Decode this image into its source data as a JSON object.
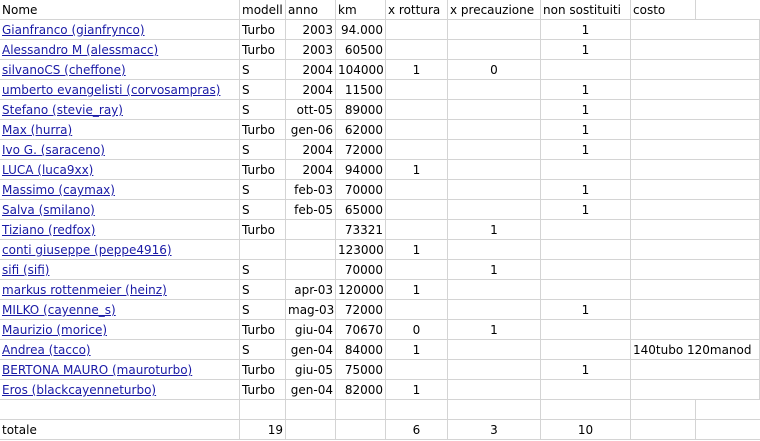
{
  "headers": [
    "Nome",
    "modell",
    "anno",
    "km",
    "x rottura",
    "x precauzione",
    "non sostituiti",
    "costo",
    ""
  ],
  "rows": [
    {
      "name": "Gianfranco (gianfrynco)",
      "modell": "Turbo",
      "anno": "2003",
      "km": "94.000",
      "rottura": "",
      "precauzione": "",
      "non_sostituiti": "1",
      "costo": ""
    },
    {
      "name": "Alessandro M (alessmacc)",
      "modell": "Turbo",
      "anno": "2003",
      "km": "60500",
      "rottura": "",
      "precauzione": "",
      "non_sostituiti": "1",
      "costo": ""
    },
    {
      "name": "silvanoCS (cheffone)",
      "modell": "S",
      "anno": "2004",
      "km": "104000",
      "rottura": "1",
      "precauzione": "0",
      "non_sostituiti": "",
      "costo": ""
    },
    {
      "name": "umberto evangelisti (corvosampras)",
      "modell": "S",
      "anno": "2004",
      "km": "11500",
      "rottura": "",
      "precauzione": "",
      "non_sostituiti": "1",
      "costo": ""
    },
    {
      "name": "Stefano (stevie_ray)",
      "modell": "S",
      "anno": "ott-05",
      "km": "89000",
      "rottura": "",
      "precauzione": "",
      "non_sostituiti": "1",
      "costo": ""
    },
    {
      "name": "Max (hurra)",
      "modell": "Turbo",
      "anno": "gen-06",
      "km": "62000",
      "rottura": "",
      "precauzione": "",
      "non_sostituiti": "1",
      "costo": ""
    },
    {
      "name": "Ivo G. (saraceno)",
      "modell": "S",
      "anno": "2004",
      "km": "72000",
      "rottura": "",
      "precauzione": "",
      "non_sostituiti": "1",
      "costo": ""
    },
    {
      "name": "LUCA (luca9xx)",
      "modell": "Turbo",
      "anno": "2004",
      "km": "94000",
      "rottura": "1",
      "precauzione": "",
      "non_sostituiti": "",
      "costo": ""
    },
    {
      "name": "Massimo (caymax)",
      "modell": "S",
      "anno": "feb-03",
      "km": "70000",
      "rottura": "",
      "precauzione": "",
      "non_sostituiti": "1",
      "costo": ""
    },
    {
      "name": "Salva (smilano)",
      "modell": "S",
      "anno": "feb-05",
      "km": "65000",
      "rottura": "",
      "precauzione": "",
      "non_sostituiti": "1",
      "costo": ""
    },
    {
      "name": "Tiziano (redfox)",
      "modell": "Turbo",
      "anno": "",
      "km": "73321",
      "rottura": "",
      "precauzione": "1",
      "non_sostituiti": "",
      "costo": ""
    },
    {
      "name": "conti giuseppe (peppe4916)",
      "modell": "",
      "anno": "",
      "km": "123000",
      "rottura": "1",
      "precauzione": "",
      "non_sostituiti": "",
      "costo": ""
    },
    {
      "name": "sifi (sifi)",
      "modell": "S",
      "anno": "",
      "km": "70000",
      "rottura": "",
      "precauzione": "1",
      "non_sostituiti": "",
      "costo": ""
    },
    {
      "name": "markus rottenmeier (heinz)",
      "modell": "S",
      "anno": "apr-03",
      "km": "120000",
      "rottura": "1",
      "precauzione": "",
      "non_sostituiti": "",
      "costo": ""
    },
    {
      "name": "MILKO (cayenne_s)",
      "modell": "S",
      "anno": "mag-03",
      "km": "72000",
      "rottura": "",
      "precauzione": "",
      "non_sostituiti": "1",
      "costo": ""
    },
    {
      "name": "Maurizio (morice)",
      "modell": "Turbo",
      "anno": "giu-04",
      "km": "70670",
      "rottura": "0",
      "precauzione": "1",
      "non_sostituiti": "",
      "costo": ""
    },
    {
      "name": "Andrea (tacco)",
      "modell": "S",
      "anno": "gen-04",
      "km": "84000",
      "rottura": "1",
      "precauzione": "",
      "non_sostituiti": "",
      "costo": "140tubo 120manod"
    },
    {
      "name": "BERTONA MAURO (mauroturbo)",
      "modell": "Turbo",
      "anno": "giu-05",
      "km": "75000",
      "rottura": "",
      "precauzione": "",
      "non_sostituiti": "1",
      "costo": ""
    },
    {
      "name": "Eros (blackcayenneturbo)",
      "modell": "Turbo",
      "anno": "gen-04",
      "km": "82000",
      "rottura": "1",
      "precauzione": "",
      "non_sostituiti": "",
      "costo": ""
    }
  ],
  "totals": {
    "label": "totale",
    "modell": "19",
    "rottura": "6",
    "precauzione": "3",
    "non_sostituiti": "10"
  }
}
